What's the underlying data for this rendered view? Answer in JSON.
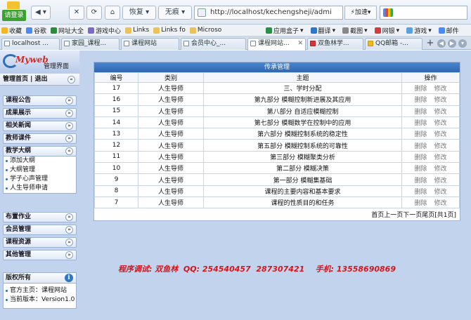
{
  "browser": {
    "login_label": "请登录",
    "restore_label": "恢复",
    "security_label": "无痕",
    "address": "http://localhost/kechengsheji/admi",
    "accelerate_label": "加速"
  },
  "bookmarks": [
    "收藏",
    "谷歌",
    "网址大全",
    "游戏中心",
    "Links",
    "Links fo",
    "Microso"
  ],
  "bookmarks_right": [
    "应用盒子",
    "翻译",
    "截图",
    "网银",
    "游戏",
    "邮件"
  ],
  "tabs": [
    "localhost ...",
    "家园_课程...",
    "课程网站",
    "会员中心_...",
    "课程网站...",
    "双鱼林学...",
    "QQ邮箱 -..."
  ],
  "sidebar": {
    "logo_text": "Myweb",
    "logo_sub": "管理界面",
    "header": "管理首页 | 退出",
    "menus_top": [
      "课程公告",
      "成果展示",
      "相关新闻",
      "教师课件",
      "教学大纲"
    ],
    "outline_items": [
      "添加大纲",
      "大纲管理",
      "学子心声管理",
      "人生导师申请"
    ],
    "menus_bottom": [
      "布置作业",
      "会员管理",
      "课程资源",
      "其他管理"
    ],
    "info_title": "版权所有",
    "info_items": [
      "官方主页：课程网站",
      "当前版本：Version1.0"
    ]
  },
  "main": {
    "panel_title": "传承管理",
    "columns": [
      "编号",
      "类别",
      "主题",
      "操作"
    ],
    "rows": [
      {
        "id": "17",
        "category": "人生导师",
        "topic": "三、学时分配"
      },
      {
        "id": "16",
        "category": "人生导师",
        "topic": "第九部分  模糊控制新进展及其应用"
      },
      {
        "id": "15",
        "category": "人生导师",
        "topic": "第八部分  自适应模糊控制"
      },
      {
        "id": "14",
        "category": "人生导师",
        "topic": "第七部分  模糊数学在控制中的应用"
      },
      {
        "id": "13",
        "category": "人生导师",
        "topic": "第六部分  模糊控制系统的稳定性"
      },
      {
        "id": "12",
        "category": "人生导师",
        "topic": "第五部分  模糊控制系统的可靠性"
      },
      {
        "id": "11",
        "category": "人生导师",
        "topic": "第三部分  模糊聚类分析"
      },
      {
        "id": "10",
        "category": "人生导师",
        "topic": "第二部分  模糊决策"
      },
      {
        "id": "9",
        "category": "人生导师",
        "topic": "第一部分  模糊集基础"
      },
      {
        "id": "8",
        "category": "人生导师",
        "topic": "课程的主要内容和基本要求"
      },
      {
        "id": "7",
        "category": "人生导师",
        "topic": "课程的性质目的和任务"
      }
    ],
    "delete_label": "删除",
    "edit_label": "修改",
    "pager": "首页上一页下一页尾页[共1页]",
    "debug_text": "程序调试: 双鱼林  QQ: 254540457  287307421    手机: 13558690869"
  }
}
